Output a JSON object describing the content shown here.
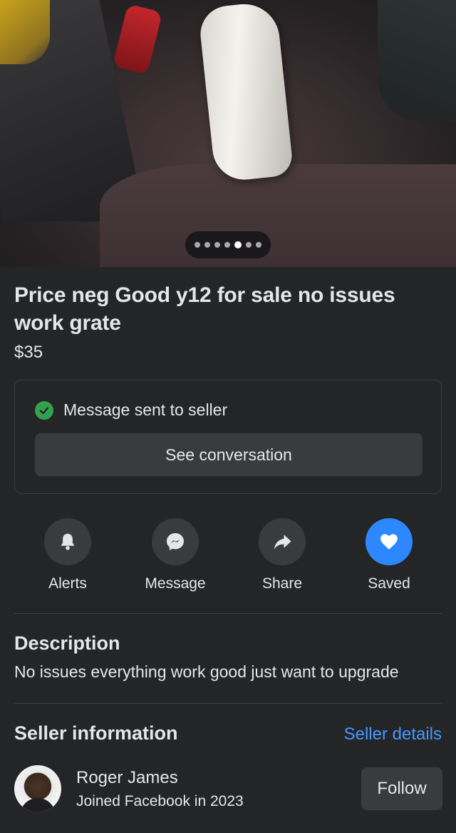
{
  "listing": {
    "title": "Price neg Good y12 for sale no issues work grate",
    "price": "$35",
    "photo_count": 7,
    "active_photo_index": 4
  },
  "message_card": {
    "status_text": "Message sent to seller",
    "button_label": "See conversation"
  },
  "actions": [
    {
      "label": "Alerts",
      "icon": "bell-icon"
    },
    {
      "label": "Message",
      "icon": "messenger-icon"
    },
    {
      "label": "Share",
      "icon": "share-arrow-icon"
    },
    {
      "label": "Saved",
      "icon": "heart-icon"
    }
  ],
  "description": {
    "heading": "Description",
    "text": "No issues everything work good just want to upgrade"
  },
  "seller": {
    "heading": "Seller information",
    "details_link": "Seller details",
    "name": "Roger James",
    "joined": "Joined Facebook in 2023",
    "follow_label": "Follow"
  },
  "colors": {
    "background": "#242526",
    "surface": "#3a3b3c",
    "accent_blue": "#2d88ff",
    "link_blue": "#4599ff",
    "success_green": "#31a24c"
  }
}
